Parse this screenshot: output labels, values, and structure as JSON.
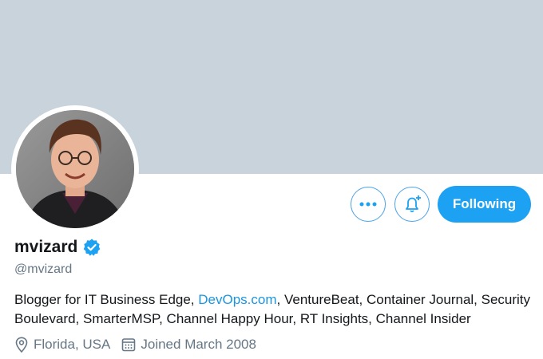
{
  "colors": {
    "banner": "#c8d3db",
    "accent": "#1da1f2",
    "link": "#1b95e0",
    "secondary_text": "#657786"
  },
  "profile": {
    "display_name": "mvizard",
    "handle": "@mvizard",
    "verified": true,
    "bio_parts": [
      "Blogger for IT Business Edge, ",
      "DevOps.com",
      ", VentureBeat, Container Journal, Security Boulevard, SmarterMSP, Channel Happy Hour, RT Insights, Channel Insider"
    ],
    "location": "Florida, USA",
    "joined": "Joined March 2008"
  },
  "actions": {
    "more_icon": "more-dots-icon",
    "notify_icon": "bell-plus-icon",
    "following_label": "Following"
  }
}
